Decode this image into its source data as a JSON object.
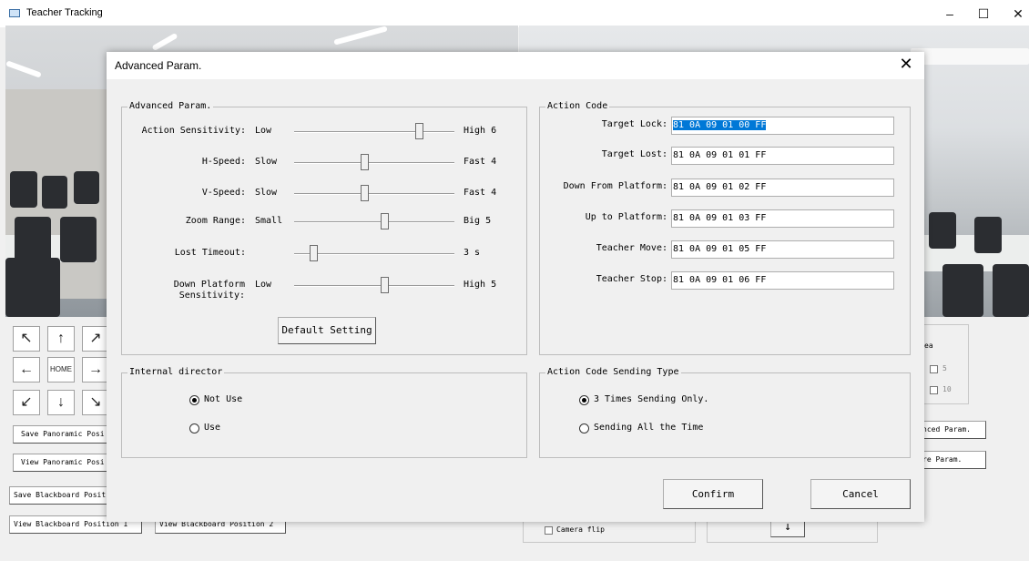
{
  "window": {
    "title": "Teacher Tracking",
    "minimize": "–",
    "maximize": "☐",
    "close": "✕"
  },
  "controls": {
    "arrows": {
      "up_left": "↖",
      "up": "↑",
      "up_right": "↗",
      "left": "←",
      "home": "HOME",
      "right": "→",
      "down_left": "↙",
      "down": "↓",
      "down_right": "↘"
    },
    "save_panoramic": "Save Panoramic Posi",
    "view_panoramic": "View Panoramic Posi",
    "save_blackboard": "Save Blackboard Posit",
    "view_blackboard_1": "View Blackboard Position 1",
    "view_blackboard_2": "View Blackboard Position 2",
    "camera_flip": "Camera flip",
    "down_arrow": "↓"
  },
  "right_panel": {
    "area_label": "ea",
    "opt_5": "5",
    "opt_10": "10",
    "advanced_param_btn": "nced Param.",
    "save_param_btn": "re Param."
  },
  "dialog": {
    "title": "Advanced Param.",
    "close": "✕",
    "advanced": {
      "group_label": "Advanced Param.",
      "sliders": [
        {
          "label": "Action Sensitivity:",
          "min": "Low",
          "max": "High 6",
          "level": 0.78
        },
        {
          "label": "H-Speed:",
          "min": "Slow",
          "max": "Fast 4",
          "level": 0.44
        },
        {
          "label": "V-Speed:",
          "min": "Slow",
          "max": "Fast 4",
          "level": 0.44
        },
        {
          "label": "Zoom Range:",
          "min": "Small",
          "max": "Big 5",
          "level": 0.56
        },
        {
          "label": "Lost Timeout:",
          "min": "",
          "max": "3 s",
          "level": 0.12
        },
        {
          "label_line1": "Down Platform",
          "label_line2": "Sensitivity:",
          "min": "Low",
          "max": "High 5",
          "level": 0.56
        }
      ],
      "default_button": "Default Setting"
    },
    "action_code": {
      "group_label": "Action Code",
      "rows": [
        {
          "label": "Target Lock:",
          "value": "81 0A 09 01 00 FF",
          "selected": true
        },
        {
          "label": "Target Lost:",
          "value": "81 0A 09 01 01 FF"
        },
        {
          "label": "Down From Platform:",
          "value": "81 0A 09 01 02 FF"
        },
        {
          "label": "Up to Platform:",
          "value": "81 0A 09 01 03 FF"
        },
        {
          "label": "Teacher Move:",
          "value": "81 0A 09 01 05 FF"
        },
        {
          "label": "Teacher Stop:",
          "value": "81 0A 09 01 06 FF"
        }
      ]
    },
    "internal_director": {
      "group_label": "Internal director",
      "options": [
        {
          "label": "Not Use",
          "checked": true
        },
        {
          "label": "Use",
          "checked": false
        }
      ]
    },
    "sending_type": {
      "group_label": "Action Code Sending Type",
      "options": [
        {
          "label": "3 Times Sending Only.",
          "checked": true
        },
        {
          "label": "Sending All the Time",
          "checked": false
        }
      ]
    },
    "confirm": "Confirm",
    "cancel": "Cancel"
  }
}
